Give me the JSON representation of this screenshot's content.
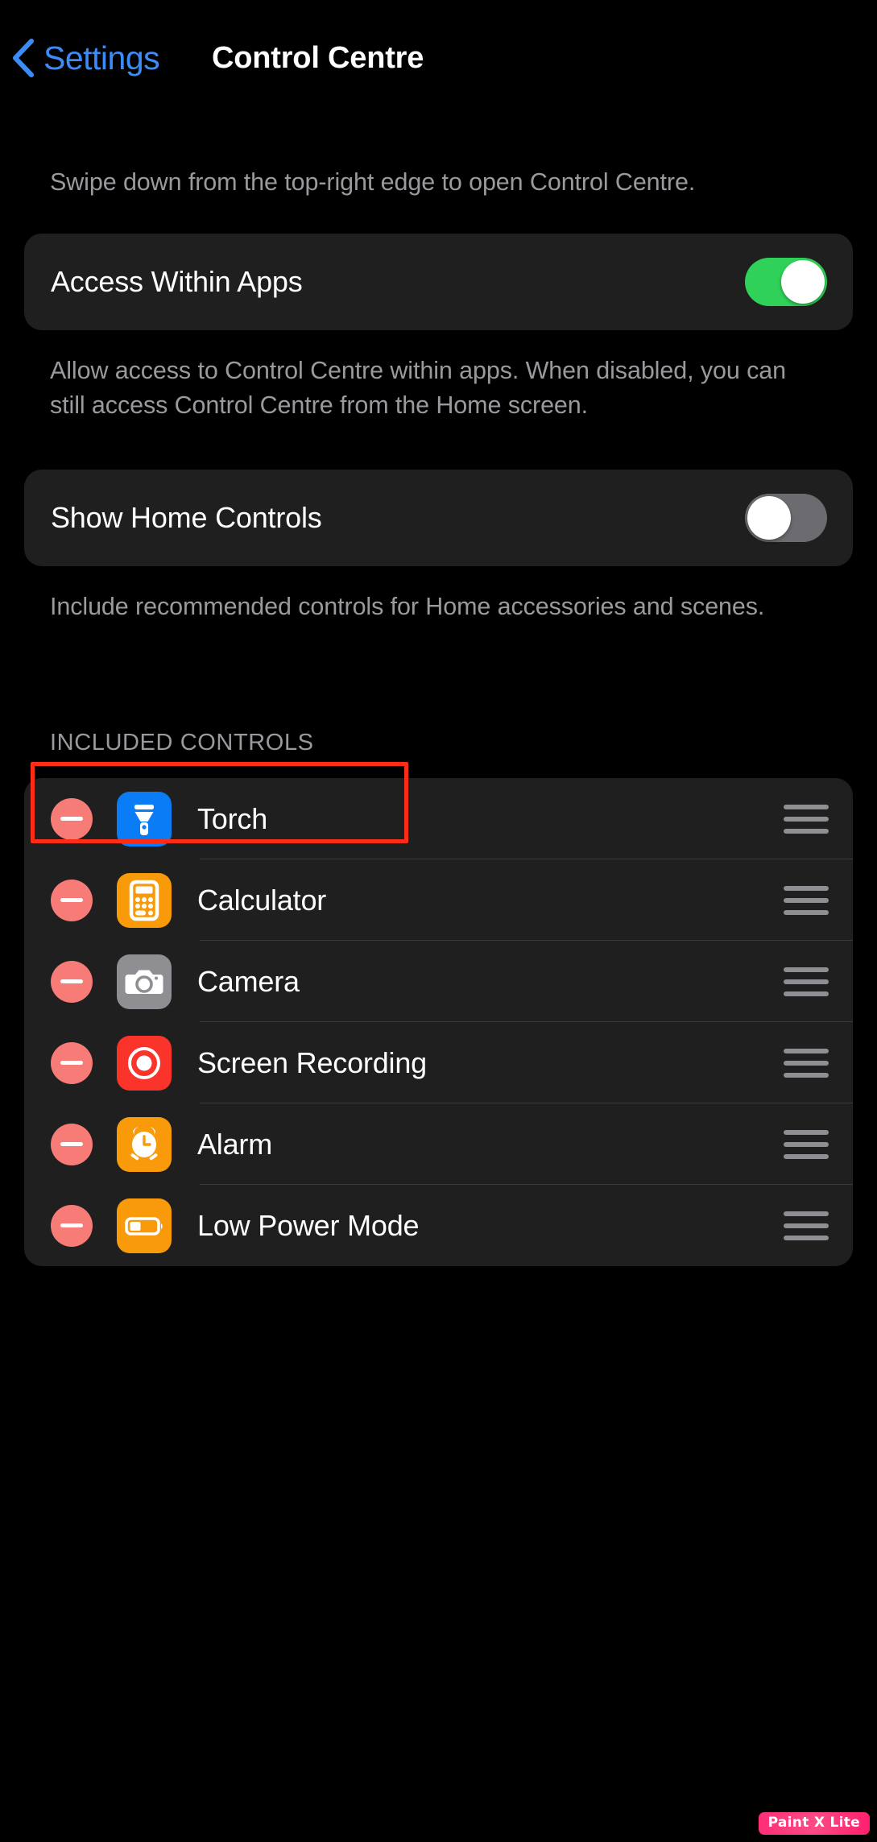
{
  "nav": {
    "back_label": "Settings",
    "title": "Control Centre",
    "back_icon": "chevron-left-icon",
    "accent_color": "#3b8cf7"
  },
  "intro_note": "Swipe down from the top-right edge to open Control Centre.",
  "access_within_apps": {
    "label": "Access Within Apps",
    "toggle_state": "on",
    "toggle_on_color": "#30d158",
    "footnote": "Allow access to Control Centre within apps. When disabled, you can still access Control Centre from the Home screen."
  },
  "show_home_controls": {
    "label": "Show Home Controls",
    "toggle_state": "off",
    "toggle_off_color": "#6c6c70",
    "footnote": "Include recommended controls for Home accessories and scenes."
  },
  "included_controls": {
    "header": "INCLUDED CONTROLS",
    "remove_icon": "minus-circle-icon",
    "drag_icon": "drag-handle-icon",
    "items": [
      {
        "label": "Torch",
        "icon": "torch-icon",
        "icon_color": "#0a7cf5"
      },
      {
        "label": "Calculator",
        "icon": "calculator-icon",
        "icon_color": "#f99a0b"
      },
      {
        "label": "Camera",
        "icon": "camera-icon",
        "icon_color": "#8e8e93"
      },
      {
        "label": "Screen Recording",
        "icon": "screen-recording-icon",
        "icon_color": "#fa342a"
      },
      {
        "label": "Alarm",
        "icon": "alarm-clock-icon",
        "icon_color": "#f99a0b"
      },
      {
        "label": "Low Power Mode",
        "icon": "battery-low-icon",
        "icon_color": "#f99a0b"
      }
    ]
  },
  "highlight": {
    "target": "Torch",
    "color": "#ff2d16"
  },
  "watermark": {
    "text": "Paint X Lite"
  }
}
